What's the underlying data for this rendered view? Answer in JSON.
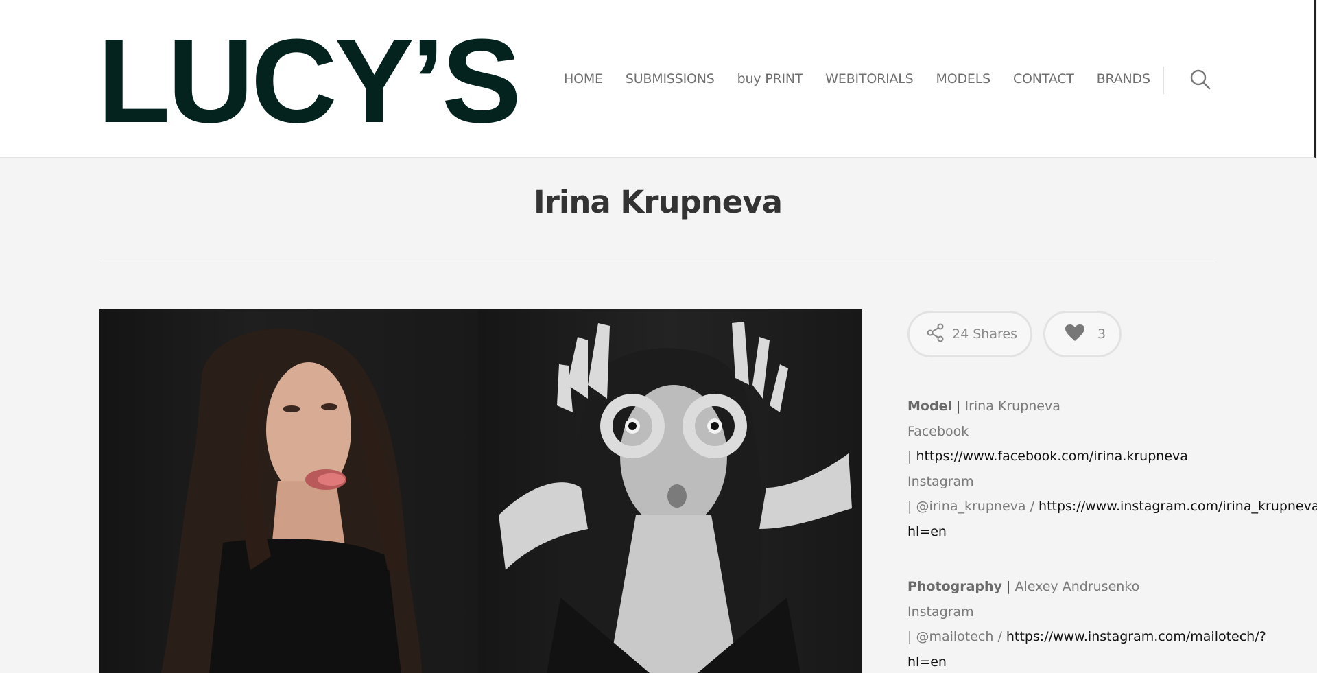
{
  "header": {
    "logo": "LUCY’S",
    "nav": [
      "HOME",
      "SUBMISSIONS",
      "buy PRINT",
      "WEBITORIALS",
      "MODELS",
      "CONTACT",
      "BRANDS"
    ],
    "search_icon": "search-icon"
  },
  "page": {
    "title": "Irina Krupneva"
  },
  "social": {
    "shares_label": "24 Shares",
    "likes_count": "3",
    "share_icon": "share-icon",
    "heart_icon": "heart-icon"
  },
  "credits": {
    "model_label": "Model",
    "model_sep": "|",
    "model_name": "Irina Krupneva",
    "model_facebook_label": "Facebook",
    "model_facebook_pipe": "|",
    "model_facebook_url": "https://www.facebook.com/irina.krupneva",
    "model_instagram_label": "Instagram",
    "model_instagram_pipe": "| @irina_krupneva /",
    "model_instagram_url": "https://www.instagram.com/irina_krupneva/?",
    "model_instagram_url_cont": "hl=en",
    "photo_label": "Photography",
    "photo_sep": "|",
    "photo_name": "Alexey Andrusenko",
    "photo_instagram_label": "Instagram",
    "photo_instagram_pipe": "| @mailotech /",
    "photo_instagram_url": "https://www.instagram.com/mailotech/?",
    "photo_instagram_url_cont": "hl=en"
  }
}
